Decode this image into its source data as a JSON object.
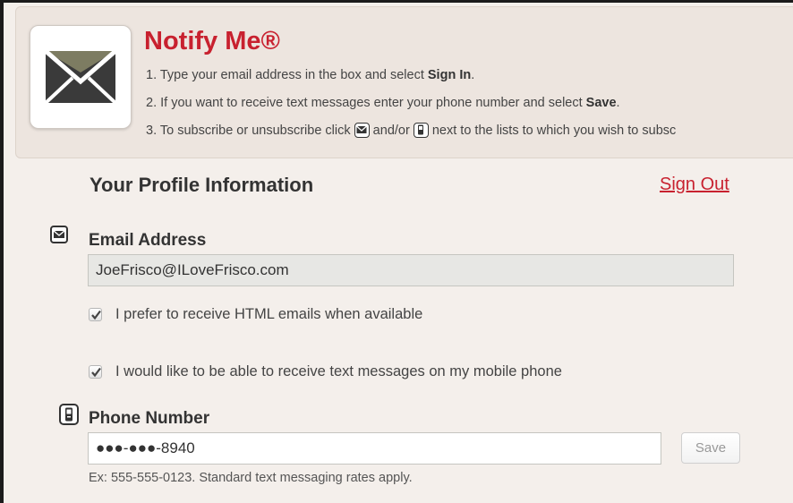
{
  "banner": {
    "title": "Notify Me®",
    "logo_icon": "envelope-icon",
    "step1_prefix": "1. Type your email address in the box and select ",
    "step1_bold": "Sign In",
    "step1_suffix": ".",
    "step2_prefix": "2. If you want to receive text messages enter your phone number and select ",
    "step2_bold": "Save",
    "step2_suffix": ".",
    "step3_prefix": "3. To subscribe or unsubscribe click ",
    "step3_middle": " and/or ",
    "step3_suffix": " next to the lists to which you wish to subsc"
  },
  "profile": {
    "title": "Your Profile Information",
    "sign_out": "Sign Out"
  },
  "email": {
    "label": "Email Address",
    "value": "JoeFrisco@ILoveFrisco.com",
    "icon": "envelope-icon",
    "html_pref_label": "I prefer to receive HTML emails when available",
    "html_pref_checked": true,
    "text_pref_label": "I would like to be able to receive text messages on my mobile phone",
    "text_pref_checked": true
  },
  "phone": {
    "label": "Phone Number",
    "value": "●●●-●●●-8940",
    "icon": "mobile-phone-icon",
    "save_label": "Save",
    "hint": "Ex: 555-555-0123. Standard text messaging rates apply."
  },
  "colors": {
    "title_red": "#c8212f",
    "envelope_flap": "#7d7c62",
    "envelope_body": "#3a3a3a"
  }
}
